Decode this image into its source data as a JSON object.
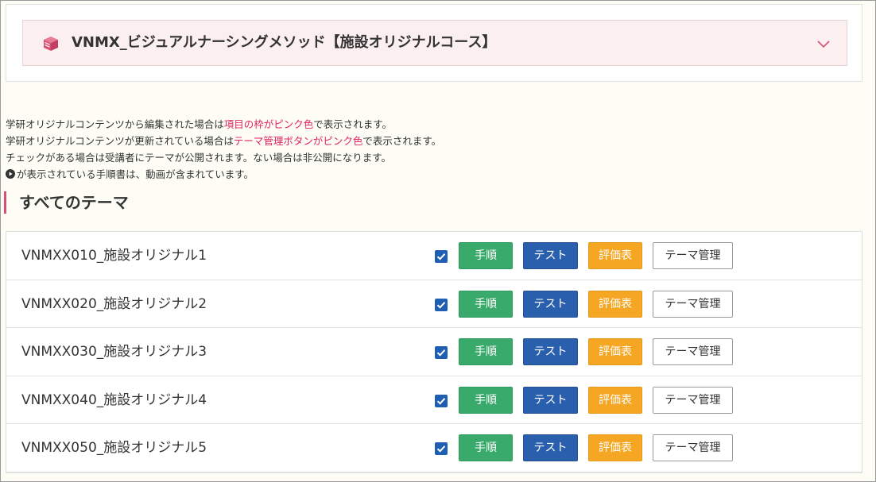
{
  "course": {
    "icon": "book-stack-icon",
    "title": "VNMX_ビジュアルナーシングメソッド【施設オリジナルコース】",
    "chevron_icon": "chevron-down-icon",
    "accent_color": "#d94f73"
  },
  "notes": {
    "line1_a": "学研オリジナルコンテンツから編集された場合は",
    "line1_b": "項目の枠がピンク色",
    "line1_c": "で表示されます。",
    "line2_a": "学研オリジナルコンテンツが更新されている場合は",
    "line2_b": "テーマ管理ボタンがピンク色",
    "line2_c": "で表示されます。",
    "line3": "チェックがある場合は受講者にテーマが公開されます。ない場合は非公開になります。",
    "line4_icon": "play-circle-icon",
    "line4": "が表示されている手順書は、動画が含まれています。"
  },
  "section": {
    "title": "すべてのテーマ"
  },
  "buttons": {
    "procedure": "手順",
    "test": "テスト",
    "evaluation": "評価表",
    "manage": "テーマ管理"
  },
  "colors": {
    "procedure": "#3aaa6c",
    "test": "#2a5fae",
    "evaluation": "#f5a623",
    "checkbox": "#1e5fb4",
    "highlight_text": "#e0245e"
  },
  "themes": [
    {
      "name": "VNMXX010_施設オリジナル1",
      "published": true
    },
    {
      "name": "VNMXX020_施設オリジナル2",
      "published": true
    },
    {
      "name": "VNMXX030_施設オリジナル3",
      "published": true
    },
    {
      "name": "VNMXX040_施設オリジナル4",
      "published": true
    },
    {
      "name": "VNMXX050_施設オリジナル5",
      "published": true
    }
  ]
}
